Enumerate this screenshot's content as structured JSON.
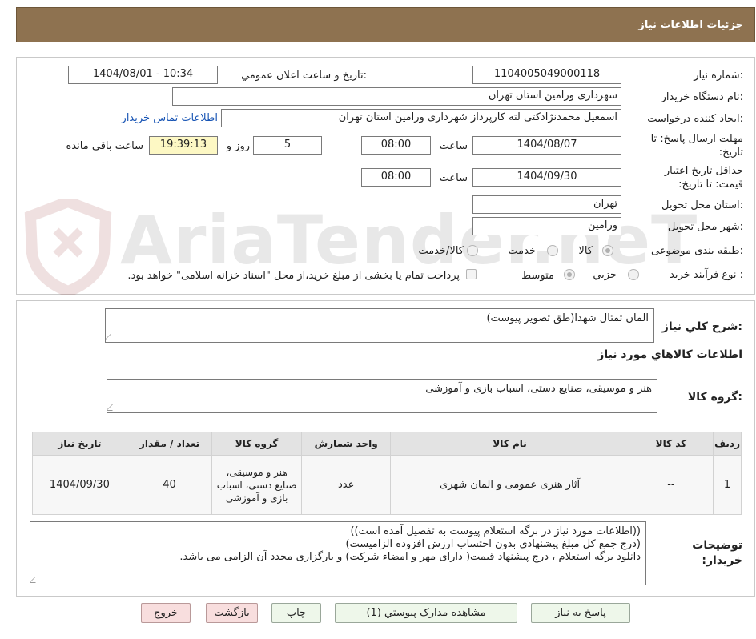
{
  "header": {
    "title": "جزئیات اطلاعات نیاز"
  },
  "watermark": {
    "text": "AriaTender.neT"
  },
  "form": {
    "need_number_label": "شماره نیاز:",
    "need_number": "1104005049000118",
    "announce_label": "تاریخ و ساعت اعلان عمومي:",
    "announce_value": "1404/08/01 - 10:34",
    "buyer_org_label": "نام دستگاه خريدار:",
    "buyer_org": "شهرداری ورامین استان تهران",
    "requester_label": "ايجاد کننده درخواست:",
    "requester": "اسمعیل محمدنژادکتی لته کارپرداز شهرداری ورامین استان تهران",
    "contact_link": "اطلاعات تماس خريدار",
    "deadline_label": "مهلت ارسال پاسخ: تا تاریخ:",
    "deadline_date": "1404/08/07",
    "time_label": "ساعت",
    "deadline_time": "08:00",
    "days": "5",
    "days_label": "روز و",
    "remaining_time": "19:39:13",
    "remaining_label": "ساعت باقي مانده",
    "validity_label": "حداقل تاريخ اعتبار قيمت: تا تاريخ:",
    "validity_date": "1404/09/30",
    "validity_time": "08:00",
    "province_label": "استان محل تحويل:",
    "province": "تهران",
    "city_label": "شهر محل تحويل:",
    "city": "ورامین",
    "category_label": "طبقه بندی موضوعی:",
    "category_options": [
      "کالا",
      "خدمت",
      "کالا/خدمت"
    ],
    "process_label": "نوع فرآيند خريد :",
    "process_options": [
      "جزيي",
      "متوسط"
    ],
    "payment_note": "پرداخت تمام یا بخشی از مبلغ خرید،از محل \"اسناد خزانه اسلامی\" خواهد بود."
  },
  "summary": {
    "desc_label": "شرح کلي نياز:",
    "desc": "المان تمثال شهدا(طق تصویر پیوست)",
    "items_title": "اطلاعات کالاهاي مورد نياز",
    "group_label": "گروه کالا:",
    "group": "هنر و موسیقی، صنایع دستی، اسباب بازی و آموزشی"
  },
  "table": {
    "headers": [
      "رديف",
      "کد کالا",
      "نام کالا",
      "واحد شمارش",
      "گروه کالا",
      "تعداد / مقدار",
      "تاريخ نياز"
    ],
    "rows": [
      [
        "1",
        "--",
        "آثار هنری عمومی و المان شهری",
        "عدد",
        "هنر و موسیقی، صنایع دستی، اسباب بازی و آموزشی",
        "40",
        "1404/09/30"
      ]
    ]
  },
  "notes": {
    "label": "توضيحات خريدار:",
    "lines": [
      "((اطلاعات مورد نیاز در برگه استعلام پیوست به تفصیل آمده است))",
      "(درج  جمع کل مبلغ پیشنهادی بدون احتساب ارزش افزوده الزامیست)",
      "دانلود برگه استعلام ، درج پیشنهاد قیمت( دارای مهر و امضاء شرکت) و بارگزاری مجدد آن الزامی می باشد."
    ]
  },
  "buttons": {
    "reply": "پاسخ به نياز",
    "view_docs": "مشاهده مدارک پيوستي (1)",
    "print": "چاپ",
    "back": "بازگشت",
    "exit": "خروج"
  }
}
